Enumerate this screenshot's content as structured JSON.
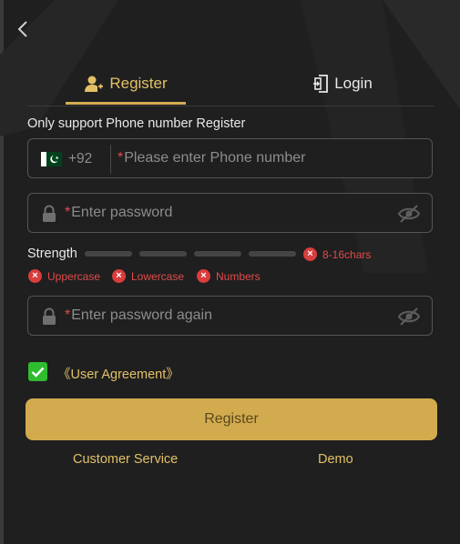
{
  "tabs": {
    "register": "Register",
    "login": "Login",
    "active": "register"
  },
  "note": "Only support Phone number Register",
  "phone": {
    "country_code": "+92",
    "flag_icon": "pakistan-flag-icon",
    "required_mark": "*",
    "placeholder": "Please enter Phone number"
  },
  "password": {
    "required_mark": "*",
    "placeholder": "Enter password"
  },
  "password_again": {
    "required_mark": "*",
    "placeholder": "Enter password again"
  },
  "strength": {
    "label": "Strength",
    "bars_filled": 0,
    "bars_total": 4,
    "rules": {
      "length": "8-16chars",
      "uppercase": "Uppercase",
      "lowercase": "Lowercase",
      "numbers": "Numbers"
    }
  },
  "agreement": {
    "checked": true,
    "label": "《User Agreement》"
  },
  "register_button": "Register",
  "links": {
    "customer_service": "Customer Service",
    "demo": "Demo"
  },
  "colors": {
    "background": "#1f1f1f",
    "accent_gold": "#d2ab4e",
    "accent_text": "#e3c067",
    "error_red": "#d93d3d",
    "check_green": "#2fbd2f"
  }
}
